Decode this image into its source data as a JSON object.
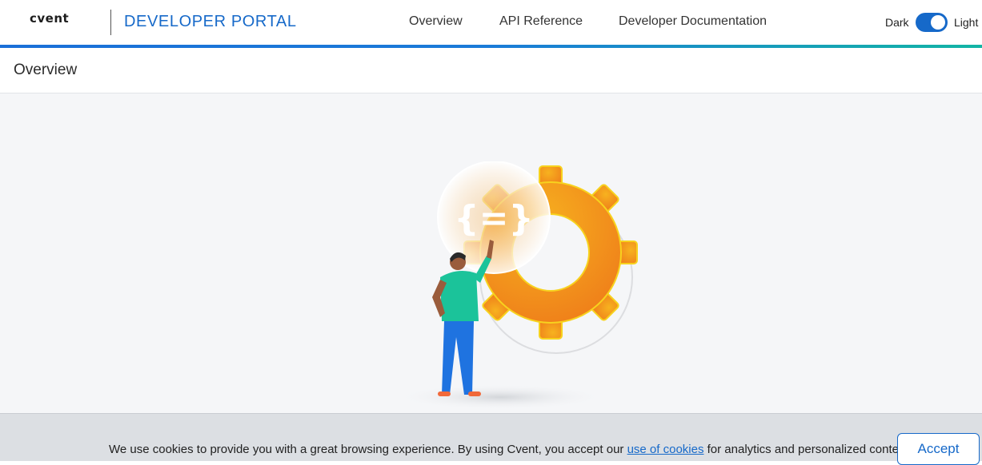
{
  "header": {
    "logo_text": "cvent",
    "portal_title": "DEVELOPER PORTAL",
    "nav": [
      {
        "label": "Overview"
      },
      {
        "label": "API Reference"
      },
      {
        "label": "Developer Documentation"
      }
    ],
    "theme": {
      "dark_label": "Dark",
      "light_label": "Light",
      "selected": "Light"
    }
  },
  "page": {
    "title": "Overview"
  },
  "illustration": {
    "badge_glyph": "{=}",
    "icons": [
      "gear-icon",
      "code-braces-icon",
      "person-figure"
    ]
  },
  "cookie_banner": {
    "text_before": "We use cookies to provide you with a great browsing experience. By using Cvent, you accept our ",
    "link_text": "use of cookies",
    "text_after": " for analytics and personalized content.",
    "accept_label": "Accept"
  },
  "colors": {
    "brand_blue": "#1669c9",
    "accent_teal": "#13b5a5",
    "gear_orange": "#f2961c",
    "background": "#f5f6f8"
  }
}
